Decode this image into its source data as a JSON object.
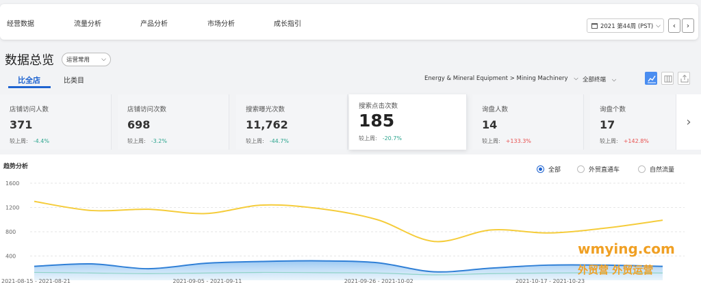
{
  "nav": {
    "items": [
      "经营数据",
      "流量分析",
      "产品分析",
      "市场分析",
      "成长指引"
    ],
    "week": "2021 第44周 (PST)"
  },
  "header": {
    "title": "数据总览",
    "preset": "运营常用",
    "tabs": [
      "比全店",
      "比类目"
    ],
    "category": "Energy & Mineral Equipment > Mining Machinery",
    "terminal": "全部终端"
  },
  "kpis": [
    {
      "label": "店铺访问人数",
      "value": "371",
      "cmp_label": "较上周:",
      "delta": "-4.4%",
      "dir": "down"
    },
    {
      "label": "店铺访问次数",
      "value": "698",
      "cmp_label": "较上周:",
      "delta": "-3.2%",
      "dir": "down"
    },
    {
      "label": "搜索曝光次数",
      "value": "11,762",
      "cmp_label": "较上周:",
      "delta": "-44.7%",
      "dir": "down"
    },
    {
      "label": "搜索点击次数",
      "value": "185",
      "cmp_label": "较上周:",
      "delta": "-20.7%",
      "dir": "down"
    },
    {
      "label": "询盘人数",
      "value": "14",
      "cmp_label": "较上周:",
      "delta": "+133.3%",
      "dir": "up"
    },
    {
      "label": "询盘个数",
      "value": "17",
      "cmp_label": "较上周:",
      "delta": "+142.8%",
      "dir": "up"
    }
  ],
  "trend": {
    "title": "趋势分析",
    "radios": [
      "全部",
      "外贸直通车",
      "自然流量"
    ],
    "selected": 0
  },
  "colors": {
    "accent": "#1e63d0",
    "down": "#2aa48d",
    "up": "#e8504f",
    "yellow": "#f5cc3a",
    "blue": "#2f7fd6"
  },
  "watermark": {
    "line1": "wmying.com",
    "line2": "外贸营 外贸运营"
  },
  "chart_data": {
    "type": "line",
    "y_ticks": [
      1600,
      1200,
      800,
      400
    ],
    "ylim": [
      0,
      1600
    ],
    "x_labels": [
      "2021-08-15 - 2021-08-21",
      "2021-09-05 - 2021-09-11",
      "2021-09-26 - 2021-10-02",
      "2021-10-17 - 2021-10-23"
    ],
    "x_label_index": [
      0,
      3,
      6,
      9
    ],
    "grid": true,
    "series": [
      {
        "color": "#f5cc3a",
        "values": [
          1300,
          1150,
          1170,
          1100,
          1240,
          1180,
          1000,
          640,
          830,
          780,
          860,
          990
        ]
      },
      {
        "color": "#2f7fd6",
        "values": [
          230,
          270,
          190,
          280,
          310,
          320,
          290,
          140,
          200,
          250,
          250,
          230
        ]
      },
      {
        "color": "#8fd3c7",
        "values": [
          130,
          120,
          110,
          120,
          130,
          125,
          120,
          90,
          110,
          120,
          125,
          120
        ]
      }
    ]
  }
}
